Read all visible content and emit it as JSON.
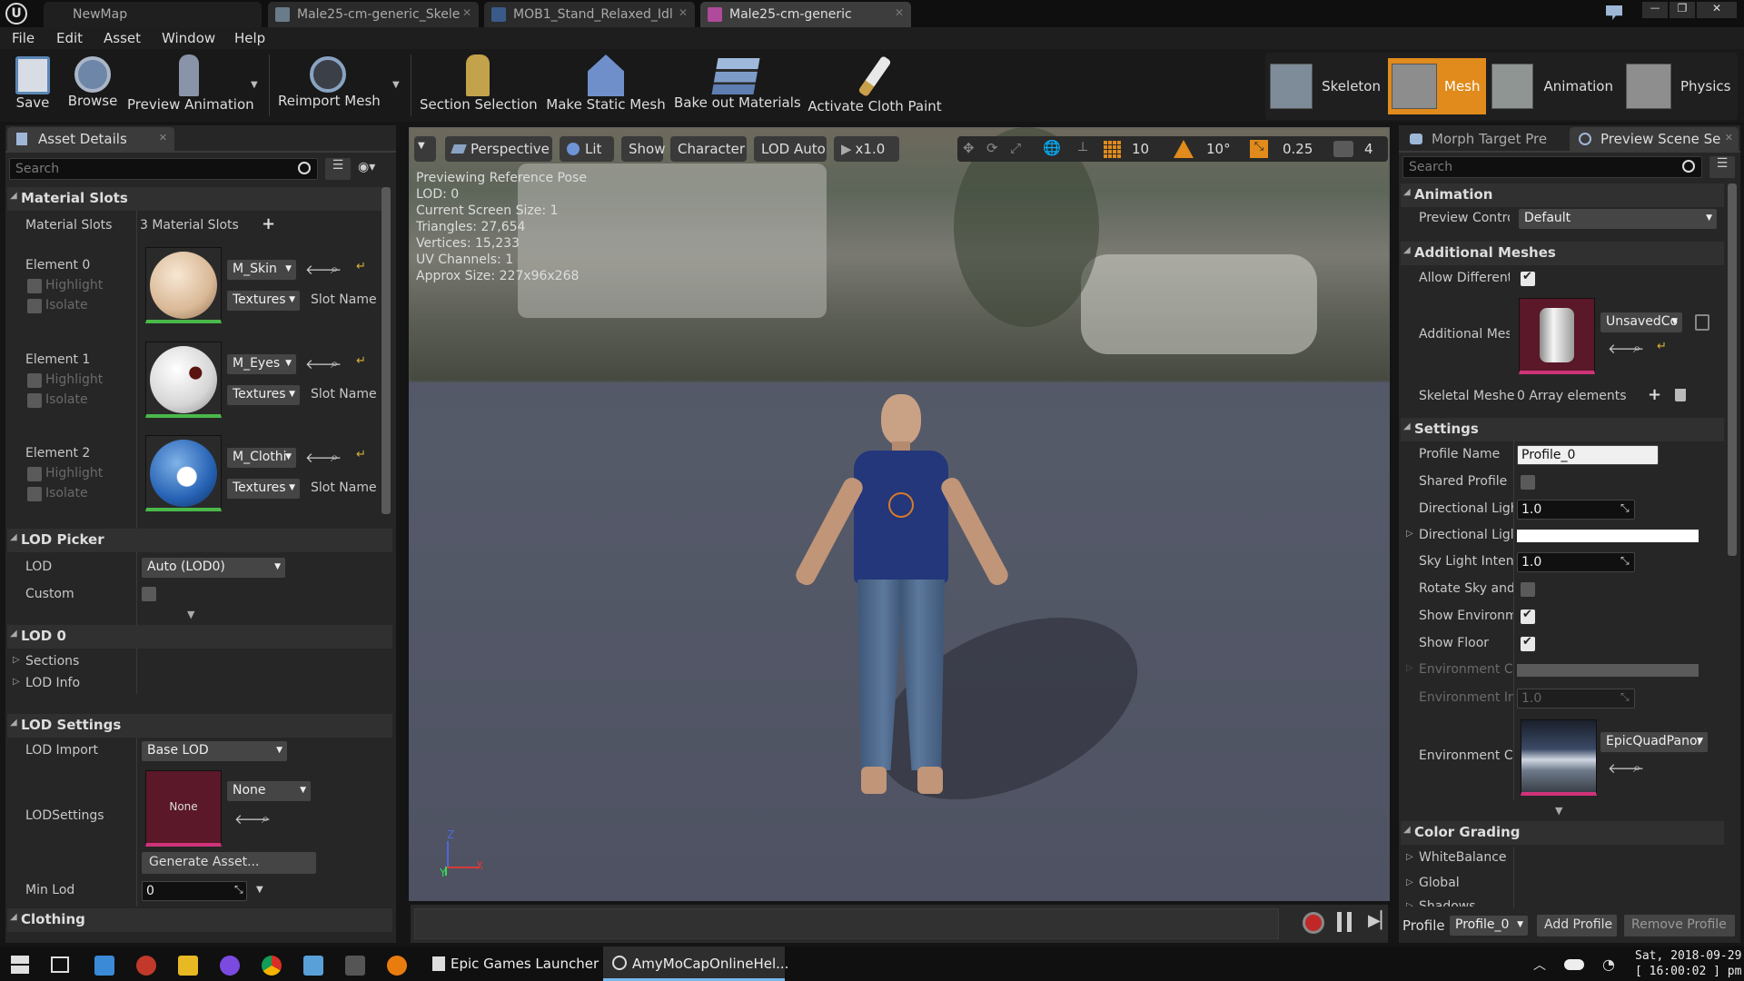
{
  "titlebar": {
    "tabs": [
      {
        "label": "NewMap"
      },
      {
        "label": "Male25-cm-generic_Skele"
      },
      {
        "label": "MOB1_Stand_Relaxed_Idl"
      },
      {
        "label": "Male25-cm-generic"
      }
    ],
    "window_controls": {
      "minimize": "—",
      "restore": "❐",
      "close": "✕"
    }
  },
  "menu": [
    "File",
    "Edit",
    "Asset",
    "Window",
    "Help"
  ],
  "toolbar": {
    "buttons": [
      {
        "label": "Save"
      },
      {
        "label": "Browse"
      },
      {
        "label": "Preview Animation"
      },
      {
        "label": "Reimport Mesh"
      },
      {
        "label": "Section Selection"
      },
      {
        "label": "Make Static Mesh"
      },
      {
        "label": "Bake out Materials"
      },
      {
        "label": "Activate Cloth Paint"
      }
    ],
    "modes": [
      {
        "label": "Skeleton",
        "active": false
      },
      {
        "label": "Mesh",
        "active": true
      },
      {
        "label": "Animation",
        "active": false
      },
      {
        "label": "Physics",
        "active": false
      }
    ],
    "accent": "#e08b1c"
  },
  "left_panel": {
    "tab_label": "Asset Details",
    "search_placeholder": "Search",
    "material_slots": {
      "header": "Material Slots",
      "row_label": "Material Slots",
      "count": "3 Material Slots",
      "elements": [
        {
          "name": "Element 0",
          "material": "M_Skin",
          "highlight": "Highlight",
          "isolate": "Isolate",
          "textures": "Textures",
          "slot_name": "Slot Name"
        },
        {
          "name": "Element 1",
          "material": "M_Eyes",
          "highlight": "Highlight",
          "isolate": "Isolate",
          "textures": "Textures",
          "slot_name": "Slot Name"
        },
        {
          "name": "Element 2",
          "material": "M_Clothi",
          "highlight": "Highlight",
          "isolate": "Isolate",
          "textures": "Textures",
          "slot_name": "Slot Name"
        }
      ]
    },
    "lod_picker": {
      "header": "LOD Picker",
      "lod_label": "LOD",
      "lod_value": "Auto (LOD0)",
      "custom_label": "Custom"
    },
    "lod0": {
      "header": "LOD 0",
      "sections": "Sections",
      "lod_info": "LOD Info"
    },
    "lod_settings": {
      "header": "LOD Settings",
      "lod_import_label": "LOD Import",
      "lod_import_value": "Base LOD",
      "lodsettings_label": "LODSettings",
      "thumb_text": "None",
      "asset_value": "None",
      "generate_button": "Generate Asset...",
      "min_lod_label": "Min Lod",
      "min_lod_value": "0"
    },
    "clothing_header": "Clothing"
  },
  "viewport": {
    "buttons": {
      "perspective": "Perspective",
      "lit": "Lit",
      "show": "Show",
      "character": "Character",
      "lod": "LOD Auto",
      "speed": "x1.0"
    },
    "grid_snap": "10",
    "rotation_snap": "10°",
    "scale_snap": "0.25",
    "camera_speed": "4",
    "stats": [
      "Previewing Reference Pose",
      "LOD: 0",
      "Current Screen Size: 1",
      "Triangles: 27,654",
      "Vertices: 15,233",
      "UV Channels: 1",
      "Approx Size: 227x96x268"
    ],
    "axis": {
      "z": "Z",
      "y": "Y",
      "x": "X"
    }
  },
  "right_panel": {
    "tabs": [
      {
        "label": "Morph Target Pre"
      },
      {
        "label": "Preview Scene Se"
      }
    ],
    "search_placeholder": "Search",
    "animation": {
      "header": "Animation",
      "preview_controller_label": "Preview Contro",
      "preview_controller_value": "Default"
    },
    "additional_meshes": {
      "header": "Additional Meshes",
      "allow_different_label": "Allow Different",
      "additional_mesh_label": "Additional Mes",
      "asset_value": "UnsavedCo",
      "skeletal_meshes_label": "Skeletal Meshe",
      "skeletal_meshes_value": "0 Array elements"
    },
    "settings": {
      "header": "Settings",
      "profile_name_label": "Profile Name",
      "profile_name_value": "Profile_0",
      "shared_profile_label": "Shared Profile",
      "directional_light_intensity_label": "Directional Ligh",
      "directional_light_intensity_value": "1.0",
      "directional_light_color_label": "Directional Ligl",
      "sky_light_label": "Sky Light Intens",
      "sky_light_value": "1.0",
      "rotate_sky_label": "Rotate Sky and",
      "show_environment_label": "Show Environm",
      "show_floor_label": "Show Floor",
      "environment_color_label": "Environment Cc",
      "environment_intensity_label": "Environment Int",
      "environment_intensity_value": "1.0",
      "environment_cubemap_label": "Environment Cu",
      "environment_cubemap_value": "EpicQuadPanor"
    },
    "color_grading": {
      "header": "Color Grading",
      "items": [
        "WhiteBalance",
        "Global",
        "Shadows"
      ]
    },
    "footer": {
      "profile_label": "Profile",
      "profile_value": "Profile_0",
      "add_profile": "Add Profile",
      "remove_profile": "Remove Profile"
    }
  },
  "taskbar": {
    "apps": [
      {
        "label": "Epic Games Launcher"
      },
      {
        "label": "AmyMoCapOnlineHel..."
      }
    ],
    "clock_line1": "Sat, 2018-09-29",
    "clock_line2": "[ 16:00:02 ] pm"
  }
}
